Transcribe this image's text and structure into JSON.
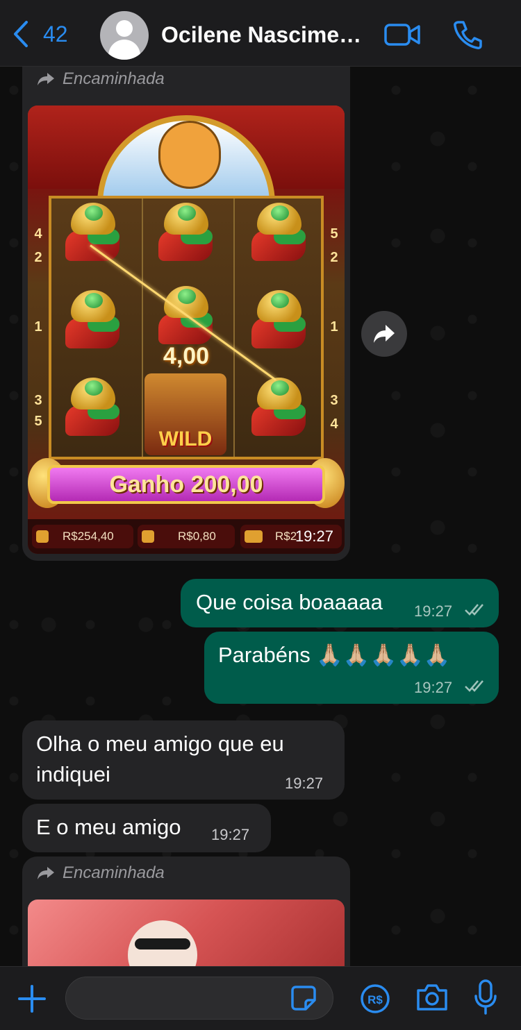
{
  "header": {
    "back_count": "42",
    "contact_name": "Ocilene Nascimen...",
    "icons": [
      "chevron-left-icon",
      "avatar",
      "video-camera-icon",
      "phone-icon"
    ]
  },
  "messages": [
    {
      "direction": "incoming",
      "forwarded_label": "Encaminhada",
      "type": "image",
      "image": {
        "payout": "4,00",
        "wild_label": "WILD",
        "win_banner": "Ganho 200,00",
        "balance": "R$254,40",
        "bet": "R$0,80",
        "win_prefix": "R$2",
        "reel_numbers_left": [
          "4",
          "2",
          "1",
          "3",
          "5"
        ],
        "reel_numbers_right": [
          "5",
          "2",
          "1",
          "3",
          "4"
        ]
      },
      "time": "19:27"
    },
    {
      "direction": "outgoing",
      "text": "Que coisa boaaaaa",
      "time": "19:27",
      "status": "read"
    },
    {
      "direction": "outgoing",
      "text": "Parabéns 🙏🏼🙏🏼🙏🏼🙏🏼🙏🏼",
      "time": "19:27",
      "status": "read"
    },
    {
      "direction": "incoming",
      "text_lines": [
        "Olha o meu amigo que eu",
        "indiquei"
      ],
      "time": "19:27"
    },
    {
      "direction": "incoming",
      "text": "E o meu amigo",
      "time": "19:27"
    },
    {
      "direction": "incoming",
      "forwarded_label": "Encaminhada",
      "type": "image",
      "partial": true
    }
  ],
  "input": {
    "placeholder": "",
    "icons": [
      "plus-icon",
      "sticker-icon",
      "payment-icon",
      "camera-icon",
      "microphone-icon"
    ]
  },
  "colors": {
    "accent": "#2a8cf0",
    "incoming_bubble": "#242426",
    "outgoing_bubble": "#005c4b",
    "header_bg": "#1c1c1e"
  }
}
